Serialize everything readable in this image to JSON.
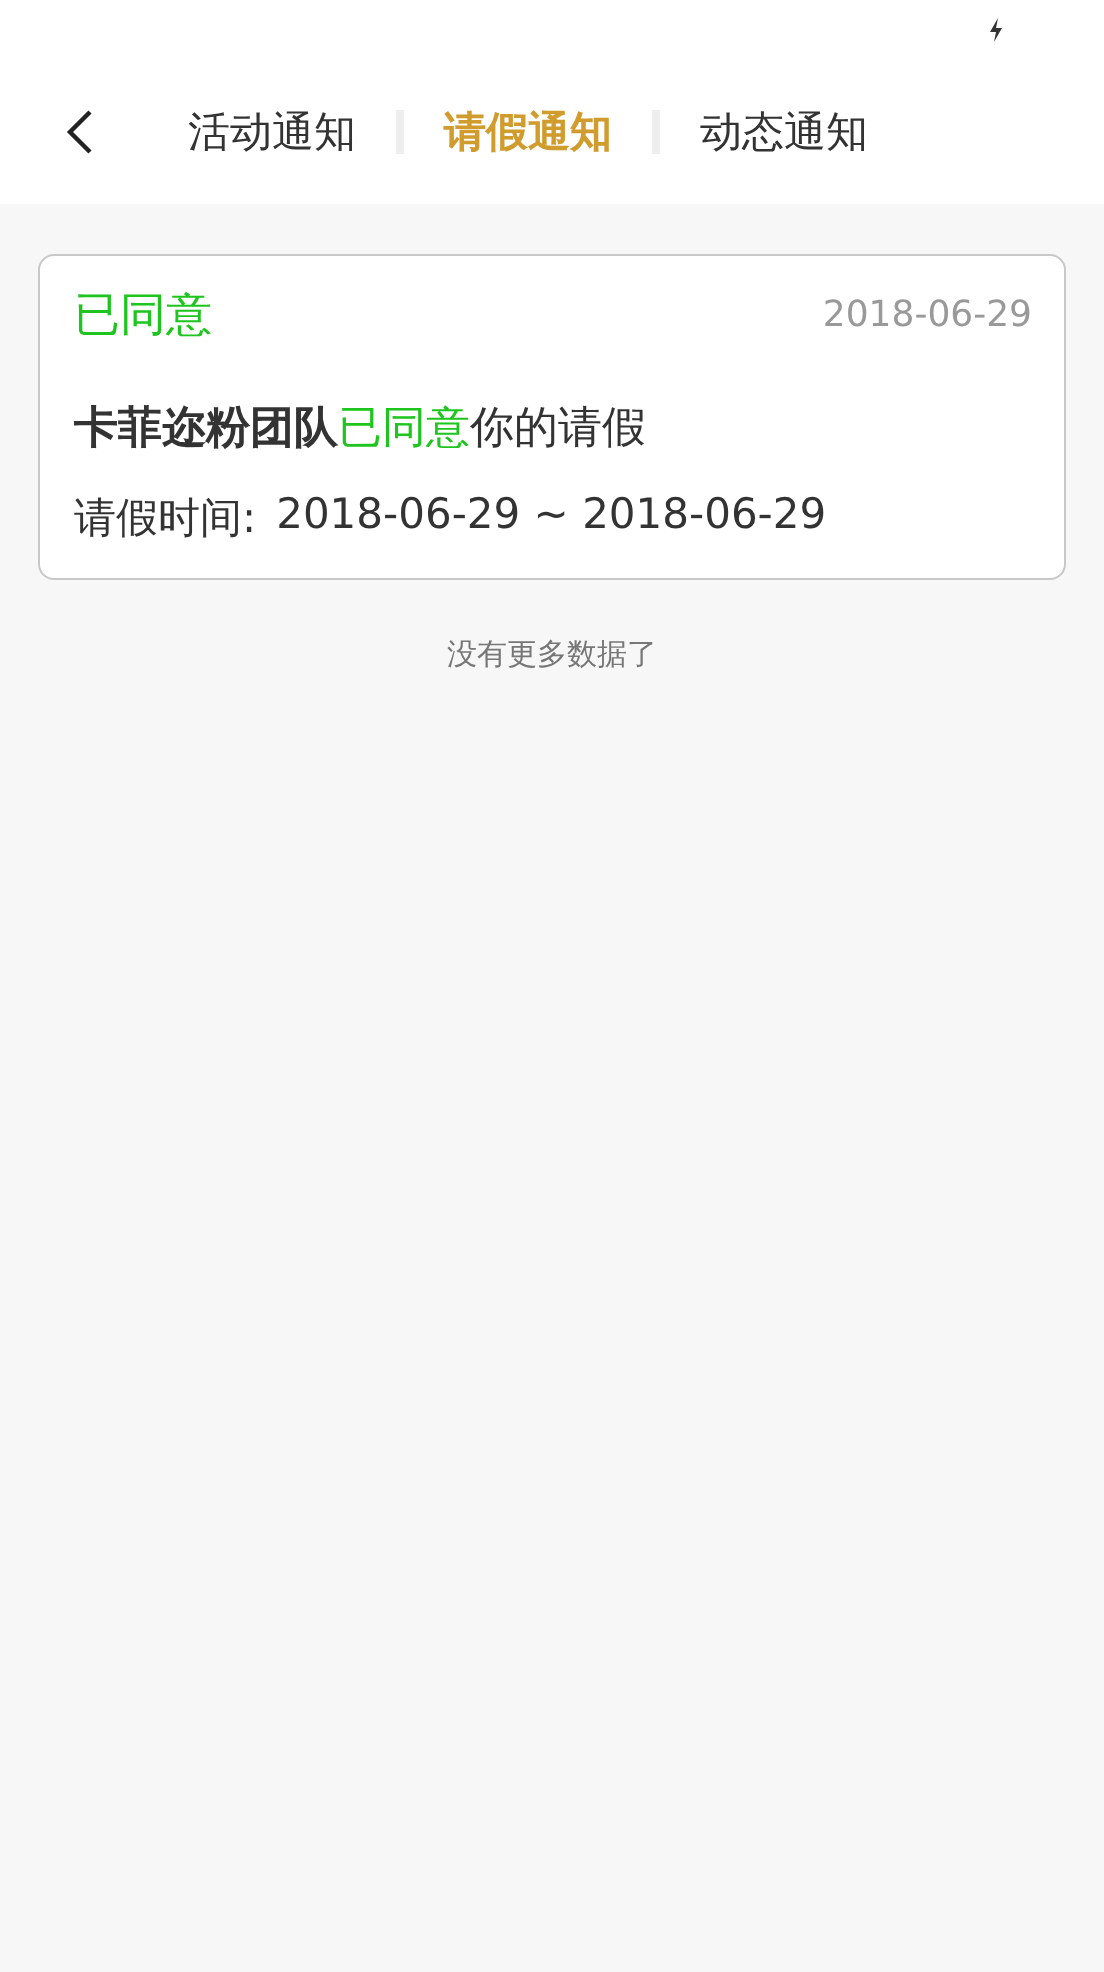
{
  "tabs": [
    {
      "label": "活动通知",
      "selected": false
    },
    {
      "label": "请假通知",
      "selected": true
    },
    {
      "label": "动态通知",
      "selected": false
    }
  ],
  "notices": [
    {
      "kind": "approved",
      "status": "已同意",
      "date": "2018-06-29",
      "team": "卡菲迩粉团队",
      "status_inline": "已同意",
      "suffix": "你的请假",
      "period_label": "请假时间:",
      "period": "2018-06-29 ~ 2018-06-29"
    }
  ],
  "footer": "没有更多数据了"
}
